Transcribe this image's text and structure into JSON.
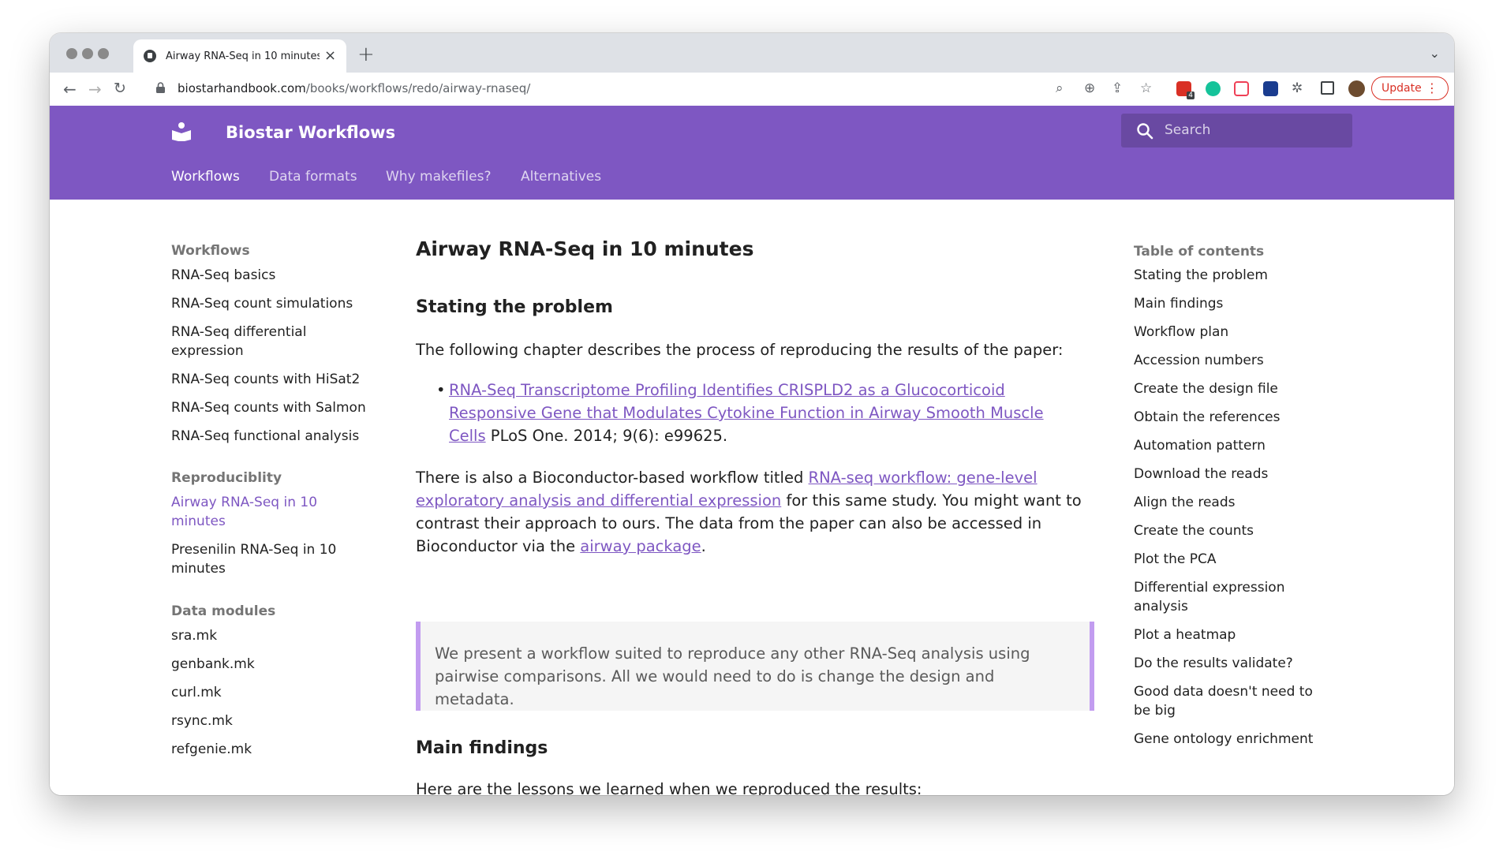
{
  "browser": {
    "tab_title": "Airway RNA-Seq in 10 minutes",
    "tab_close": "×",
    "new_tab": "+",
    "url_host": "biostarhandbook.com",
    "url_path": "/books/workflows/redo/airway-rnaseq/",
    "update_label": "Update",
    "extension_badge": "4"
  },
  "site": {
    "title": "Biostar Workflows",
    "search_placeholder": "Search",
    "nav_tabs": [
      "Workflows",
      "Data formats",
      "Why makefiles?",
      "Alternatives"
    ],
    "active_tab": "Workflows"
  },
  "sidebar": {
    "sections": [
      {
        "heading": "Workflows",
        "items": [
          "RNA-Seq basics",
          "RNA-Seq count simulations",
          "RNA-Seq differential expression",
          "RNA-Seq counts with HiSat2",
          "RNA-Seq counts with Salmon",
          "RNA-Seq functional analysis"
        ]
      },
      {
        "heading": "Reproduciblity",
        "items": [
          "Airway RNA-Seq in 10 minutes",
          "Presenilin RNA-Seq in 10 minutes"
        ]
      },
      {
        "heading": "Data modules",
        "items": [
          "sra.mk",
          "genbank.mk",
          "curl.mk",
          "rsync.mk",
          "refgenie.mk"
        ]
      }
    ],
    "current_item": "Airway RNA-Seq in 10 minutes"
  },
  "article": {
    "title": "Airway RNA-Seq in 10 minutes",
    "h2_problem": "Stating the problem",
    "intro": "The following chapter describes the process of reproducing the results of the paper:",
    "paper_link": "RNA-Seq Transcriptome Profiling Identifies CRISPLD2 as a Glucocorticoid Responsive Gene that Modulates Cytokine Function in Airway Smooth Muscle Cells",
    "paper_citation": " PLoS One. 2014; 9(6): e99625.",
    "p2_before": "There is also a Bioconductor-based workflow titled ",
    "p2_link": "RNA-seq workflow: gene-level exploratory analysis and differential expression",
    "p2_middle": " for this same study. You might want to contrast their approach to ours. The data from the paper can also be accessed in Bioconductor via the ",
    "p2_link2": "airway package",
    "p2_end": ".",
    "quote": "We present a workflow suited to reproduce any other RNA-Seq analysis using pairwise comparisons. All we would need to do is change the design and metadata.",
    "h2_findings": "Main findings",
    "findings_intro": "Here are the lessons we learned when we reproduced the results:"
  },
  "toc": {
    "heading": "Table of contents",
    "items": [
      "Stating the problem",
      "Main findings",
      "Workflow plan",
      "Accession numbers",
      "Create the design file",
      "Obtain the references",
      "Automation pattern",
      "Download the reads",
      "Align the reads",
      "Create the counts",
      "Plot the PCA",
      "Differential expression analysis",
      "Plot a heatmap",
      "Do the results validate?",
      "Good data doesn't need to be big",
      "Gene ontology enrichment"
    ]
  },
  "colors": {
    "brand": "#7e57c2",
    "quote_border": "#c29cf0",
    "update_red": "#d93025"
  }
}
